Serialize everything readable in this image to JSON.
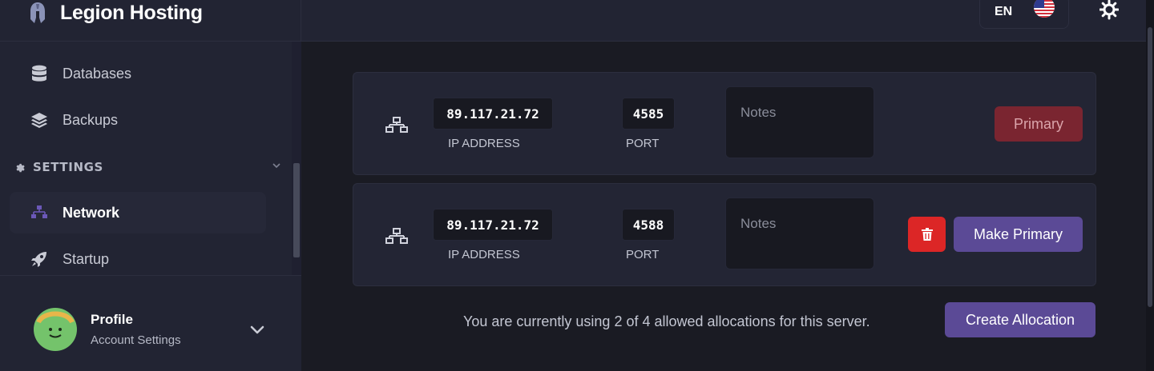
{
  "brand": {
    "name": "Legion Hosting",
    "logo_icon": "spartan-helmet-icon"
  },
  "sidebar": {
    "items": [
      {
        "label": "Databases",
        "icon": "database-icon"
      },
      {
        "label": "Backups",
        "icon": "layers-icon"
      }
    ],
    "section": {
      "label": "SETTINGS",
      "icon": "gear-icon",
      "chevron": "chevron-down-icon"
    },
    "settings_items": [
      {
        "label": "Network",
        "icon": "network-icon",
        "active": true
      },
      {
        "label": "Startup",
        "icon": "rocket-icon"
      }
    ]
  },
  "profile": {
    "name": "Profile",
    "subtitle": "Account Settings"
  },
  "topbar": {
    "language": "EN",
    "flag": "us-flag-icon",
    "settings_icon": "gear-icon"
  },
  "allocations": [
    {
      "ip": "89.117.21.72",
      "port": "4585",
      "ip_label": "IP ADDRESS",
      "port_label": "PORT",
      "notes_placeholder": "Notes",
      "action": "Primary",
      "is_primary": true
    },
    {
      "ip": "89.117.21.72",
      "port": "4588",
      "ip_label": "IP ADDRESS",
      "port_label": "PORT",
      "notes_placeholder": "Notes",
      "action": "Make Primary",
      "is_primary": false
    }
  ],
  "footer": {
    "usage_text": "You are currently using 2 of 4 allowed allocations for this server.",
    "create_label": "Create Allocation"
  },
  "colors": {
    "accent": "#5b4a96",
    "danger": "#dc2626",
    "primary_disabled": "#7a2530",
    "background": "#1a1b23",
    "sidebar": "#222433"
  }
}
